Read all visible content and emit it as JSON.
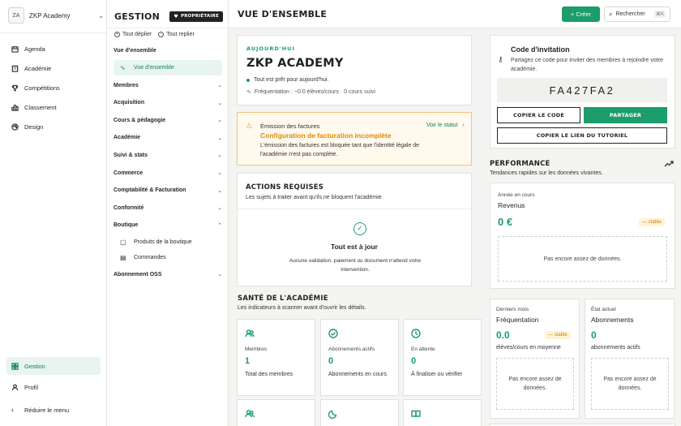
{
  "workspace": {
    "initials": "ZA",
    "name": "ZKP Academy"
  },
  "rail": {
    "items": [
      {
        "label": "Agenda",
        "icon": "calendar-icon"
      },
      {
        "label": "Académie",
        "icon": "building-icon"
      },
      {
        "label": "Compétitions",
        "icon": "trophy-icon"
      },
      {
        "label": "Classement",
        "icon": "chart-icon"
      },
      {
        "label": "Design",
        "icon": "palette-icon"
      }
    ],
    "bottom": {
      "gestion": "Gestion",
      "profil": "Profil",
      "reduce": "Réduire le menu"
    }
  },
  "section_nav": {
    "title": "GESTION",
    "owner_badge": "PROPRIÉTAIRE",
    "expand_all": "Tout déplier",
    "collapse_all": "Tout replier",
    "overview_group": "Vue d'ensemble",
    "overview_item": "Vue d'ensemble",
    "groups": [
      "Membres",
      "Acquisition",
      "Cours & pédagogie",
      "Académie",
      "Suivi & stats",
      "Commerce",
      "Comptabilité & Facturation",
      "Conformité"
    ],
    "shop_group": "Boutique",
    "shop_items": [
      "Produits de la boutique",
      "Commandes"
    ],
    "oss_group": "Abonnement OSS"
  },
  "topbar": {
    "title": "VUE D'ENSEMBLE",
    "create_label": "+ Créer",
    "search_label": "Rechercher",
    "search_shortcut": "⌘K"
  },
  "hero": {
    "eyebrow": "AUJOURD'HUI",
    "title": "ZKP ACADEMY",
    "status": "Tout est prêt pour aujourd'hui.",
    "frequency": "Fréquentation : ~0.0 élèves/cours · 0 cours suivi"
  },
  "warning": {
    "title": "Émission des factures",
    "headline": "Configuration de facturation incomplète",
    "body": "L'émission des factures est bloquée tant que l'identité légale de l'académie n'est pas complète.",
    "link": "Voir le statut"
  },
  "actions": {
    "title": "ACTIONS REQUISES",
    "subtitle": "Les sujets à traiter avant qu'ils ne bloquent l'académie.",
    "ok_title": "Tout est à jour",
    "ok_subtitle": "Aucune validation, paiement ou document n'attend votre intervention."
  },
  "health": {
    "title": "SANTÉ DE L'ACADÉMIE",
    "subtitle": "Les indicateurs à scanner avant d'ouvrir les détails.",
    "stats": [
      {
        "label": "Membres",
        "value": "1",
        "caption": "Total des membres",
        "icon": "members-icon"
      },
      {
        "label": "Abonnements actifs",
        "value": "0",
        "caption": "Abonnements en cours",
        "icon": "check-circle-icon"
      },
      {
        "label": "En attente",
        "value": "0",
        "caption": "À finaliser ou vérifier",
        "icon": "clock-icon"
      }
    ]
  },
  "invite": {
    "title": "Code d'invitation",
    "subtitle": "Partagez ce code pour inviter des membres à rejoindre votre académie.",
    "code": "FA427FA2",
    "copy_code": "COPIER LE CODE",
    "share": "PARTAGER",
    "copy_link": "COPIER LE LIEN DU TUTORIEL"
  },
  "performance": {
    "title": "PERFORMANCE",
    "subtitle": "Tendances rapides sur les données vivantes.",
    "revenue": {
      "period": "Année en cours",
      "title": "Revenus",
      "value": "0 €",
      "trend": "— stable",
      "empty": "Pas encore assez de données."
    },
    "attendance": {
      "period": "Derniers mois",
      "title": "Fréquentation",
      "value": "0.0",
      "trend": "— stable",
      "caption": "élèves/cours en moyenne",
      "empty": "Pas encore assez de données."
    },
    "subscriptions": {
      "period": "État actuel",
      "title": "Abonnements",
      "value": "0",
      "caption": "abonnements actifs",
      "empty": "Pas encore assez de données."
    }
  },
  "colors": {
    "accent": "#1c9d6b",
    "warning": "#e08a00",
    "dark": "#1f2421"
  }
}
